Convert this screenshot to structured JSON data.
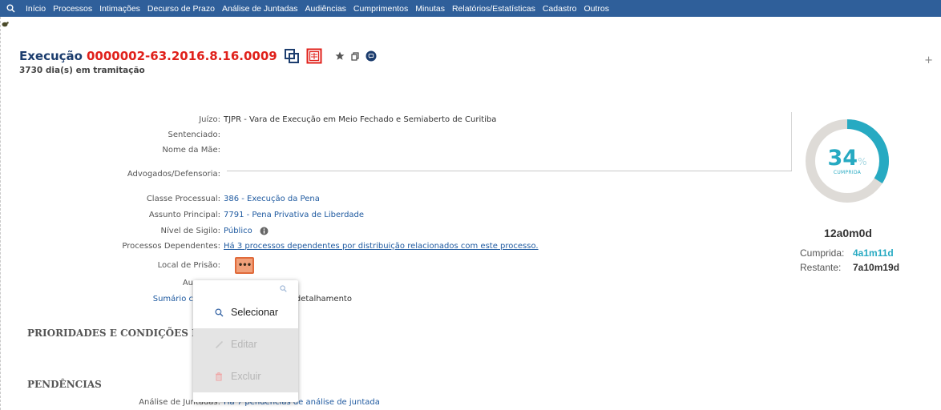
{
  "nav": {
    "search_icon": "search-icon",
    "items": [
      "Início",
      "Processos",
      "Intimações",
      "Decurso de Prazo",
      "Análise de Juntadas",
      "Audiências",
      "Cumprimentos",
      "Minutas",
      "Relatórios/Estatísticas",
      "Cadastro",
      "Outros"
    ]
  },
  "header": {
    "type": "Execução",
    "number": "0000002-63.2016.8.16.0009",
    "days": "3730 dia(s) em tramitação",
    "plus": "+"
  },
  "details": {
    "juizo_label": "Juízo:",
    "juizo_value": "TJPR - Vara de Execução em Meio Fechado e Semiaberto de Curitiba",
    "sentenciado_label": "Sentenciado:",
    "mae_label": "Nome da Mãe:",
    "advogados_label": "Advogados/Defensoria:",
    "classe_label": "Classe Processual:",
    "classe_value": "386 - Execução da Pena",
    "assunto_label": "Assunto Principal:",
    "assunto_value": "7791 - Pena Privativa de Liberdade",
    "sigilo_label": "Nível de Sigilo:",
    "sigilo_value": "Público",
    "dependentes_label": "Processos Dependentes:",
    "dependentes_value": "Há 3 processos dependentes por distribuição relacionados com este processo.",
    "prisao_label": "Local de Prisão:",
    "prisao_button": "•••",
    "aud_label": "Au",
    "sumario_label": "Sumário c",
    "sumario_value": "para detalhamento",
    "juntadas_label": "Análise de Juntadas:",
    "juntadas_value": "Há 7 pendências de análise de juntada"
  },
  "sections": {
    "prioridades": "PRIORIDADES E CONDIÇÕES DE A",
    "pendencias": "PENDÊNCIAS"
  },
  "dropdown": {
    "select_label": "Selecionar",
    "edit_label": "Editar",
    "delete_label": "Excluir"
  },
  "progress": {
    "percent": 34,
    "percent_text": "34",
    "percent_sign": "%",
    "caption": "CUMPRIDA",
    "total": "12a0m0d",
    "cumprida_label": "Cumprida:",
    "cumprida_value": "4a1m11d",
    "restante_label": "Restante:",
    "restante_value": "7a10m19d",
    "colors": {
      "fill": "#27aac2",
      "track": "#dedbd7"
    }
  }
}
